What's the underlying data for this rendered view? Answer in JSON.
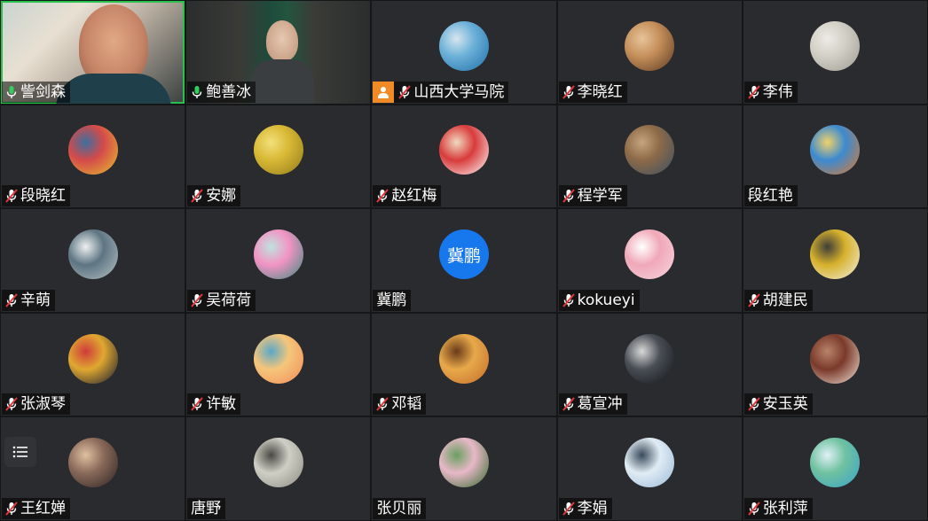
{
  "participants": [
    {
      "name": "訾剑森",
      "mic": "on",
      "type": "video1",
      "active": true
    },
    {
      "name": "鲍善冰",
      "mic": "on",
      "type": "video2"
    },
    {
      "name": "山西大学马院",
      "mic": "muted",
      "type": "img",
      "badge": "user-icon",
      "colors": [
        "#1e6fa8",
        "#6bb0d8",
        "#d6e6f0"
      ]
    },
    {
      "name": "李晓红",
      "mic": "muted",
      "type": "img",
      "colors": [
        "#5a3a22",
        "#c58f5a",
        "#e6c49a"
      ]
    },
    {
      "name": "李伟",
      "mic": "muted",
      "type": "img",
      "colors": [
        "#9c9a92",
        "#d2cfc6",
        "#ecebe5"
      ]
    },
    {
      "name": "段晓红",
      "mic": "muted",
      "type": "img",
      "colors": [
        "#e7c22d",
        "#d44a4a",
        "#3d6f9e"
      ]
    },
    {
      "name": "安娜",
      "mic": "muted",
      "type": "img",
      "colors": [
        "#8f7a1a",
        "#d8b835",
        "#f3e07a"
      ]
    },
    {
      "name": "赵红梅",
      "mic": "muted",
      "type": "img",
      "colors": [
        "#ffffff",
        "#d83b3b",
        "#f1d9c0"
      ]
    },
    {
      "name": "程学军",
      "mic": "muted",
      "type": "img",
      "colors": [
        "#3a4f63",
        "#8c6a48",
        "#c6a47c"
      ]
    },
    {
      "name": "段红艳",
      "mic": "none",
      "type": "img",
      "colors": [
        "#e27a2a",
        "#3c8ad0",
        "#f0d26a"
      ]
    },
    {
      "name": "辛萌",
      "mic": "muted",
      "type": "img",
      "colors": [
        "#b7c2c5",
        "#5d7582",
        "#eef1f1"
      ]
    },
    {
      "name": "吴荷荷",
      "mic": "muted",
      "type": "img",
      "colors": [
        "#3a8a7d",
        "#f294c4",
        "#bfe3df"
      ]
    },
    {
      "name": "冀鹏",
      "mic": "none",
      "type": "text",
      "avatarText": "冀鹏"
    },
    {
      "name": "kokueyi",
      "mic": "muted",
      "type": "img",
      "colors": [
        "#f7d7e0",
        "#f0a8b8",
        "#ffffff"
      ]
    },
    {
      "name": "胡建民",
      "mic": "muted",
      "type": "img",
      "colors": [
        "#f2f0e6",
        "#d6b12c",
        "#3e3e3a"
      ]
    },
    {
      "name": "张淑琴",
      "mic": "muted",
      "type": "img",
      "colors": [
        "#0f1630",
        "#e0a830",
        "#cf3b3b"
      ]
    },
    {
      "name": "许敏",
      "mic": "muted",
      "type": "img",
      "colors": [
        "#f08a5a",
        "#f5c67a",
        "#5aa7c8"
      ]
    },
    {
      "name": "邓韬",
      "mic": "muted",
      "type": "img",
      "colors": [
        "#c26a2a",
        "#e8a94a",
        "#6a3a1a"
      ]
    },
    {
      "name": "葛宣冲",
      "mic": "muted",
      "type": "img",
      "colors": [
        "#101214",
        "#4a4e55",
        "#d8d8d8"
      ]
    },
    {
      "name": "安玉英",
      "mic": "muted",
      "type": "img",
      "colors": [
        "#f3e6dc",
        "#7a3a2a",
        "#b8836a"
      ]
    },
    {
      "name": "王红婵",
      "mic": "muted",
      "type": "img",
      "colors": [
        "#2a2220",
        "#8a6a5a",
        "#e0c0a0"
      ],
      "menu": true
    },
    {
      "name": "唐野",
      "mic": "none",
      "type": "img",
      "colors": [
        "#8a8a80",
        "#cfcfc5",
        "#4a4a45"
      ]
    },
    {
      "name": "张贝丽",
      "mic": "none",
      "type": "img",
      "colors": [
        "#2f6a2a",
        "#e8b8c8",
        "#6aa060"
      ]
    },
    {
      "name": "李娟",
      "mic": "muted",
      "type": "img",
      "colors": [
        "#9ab8d8",
        "#e0ecf4",
        "#3a4a5a"
      ]
    },
    {
      "name": "张利萍",
      "mic": "muted",
      "type": "img",
      "colors": [
        "#3aa3c8",
        "#6fc1a0",
        "#e0f0f5"
      ]
    }
  ]
}
